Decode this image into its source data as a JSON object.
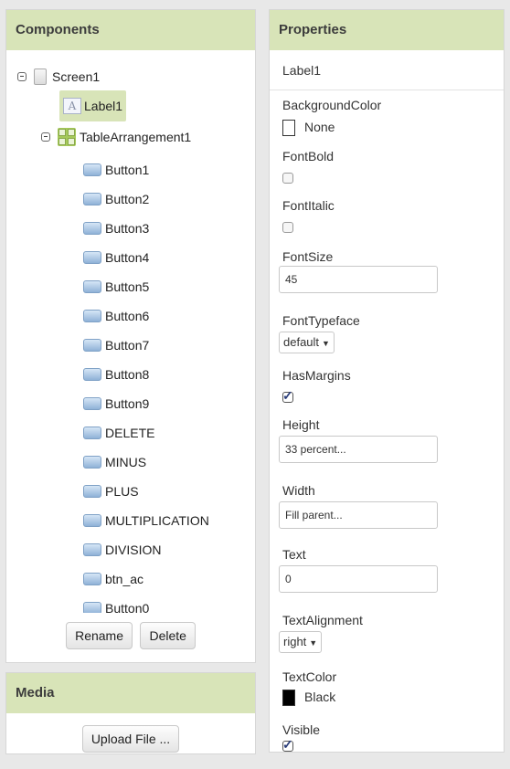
{
  "components": {
    "title": "Components",
    "tree": {
      "screen": "Screen1",
      "label": "Label1",
      "table": "TableArrangement1",
      "buttons": [
        "Button1",
        "Button2",
        "Button3",
        "Button4",
        "Button5",
        "Button6",
        "Button7",
        "Button8",
        "Button9",
        "DELETE",
        "MINUS",
        "PLUS",
        "MULTIPLICATION",
        "DIVISION",
        "btn_ac",
        "Button0"
      ]
    },
    "rename_label": "Rename",
    "delete_label": "Delete"
  },
  "media": {
    "title": "Media",
    "upload_label": "Upload File ..."
  },
  "properties": {
    "title": "Properties",
    "component": "Label1",
    "background_color": {
      "label": "BackgroundColor",
      "value": "None",
      "swatch": "#ffffff"
    },
    "font_bold": {
      "label": "FontBold",
      "checked": false
    },
    "font_italic": {
      "label": "FontItalic",
      "checked": false
    },
    "font_size": {
      "label": "FontSize",
      "value": "45"
    },
    "font_typeface": {
      "label": "FontTypeface",
      "value": "default"
    },
    "has_margins": {
      "label": "HasMargins",
      "checked": true
    },
    "height": {
      "label": "Height",
      "value": "33 percent..."
    },
    "width": {
      "label": "Width",
      "value": "Fill parent..."
    },
    "text": {
      "label": "Text",
      "value": "0"
    },
    "text_alignment": {
      "label": "TextAlignment",
      "value": "right"
    },
    "text_color": {
      "label": "TextColor",
      "value": "Black",
      "swatch": "#000000"
    },
    "visible": {
      "label": "Visible",
      "checked": true
    }
  },
  "colors": {
    "header_bg": "#d8e4b8",
    "selected_bg": "#d8e4b8"
  }
}
